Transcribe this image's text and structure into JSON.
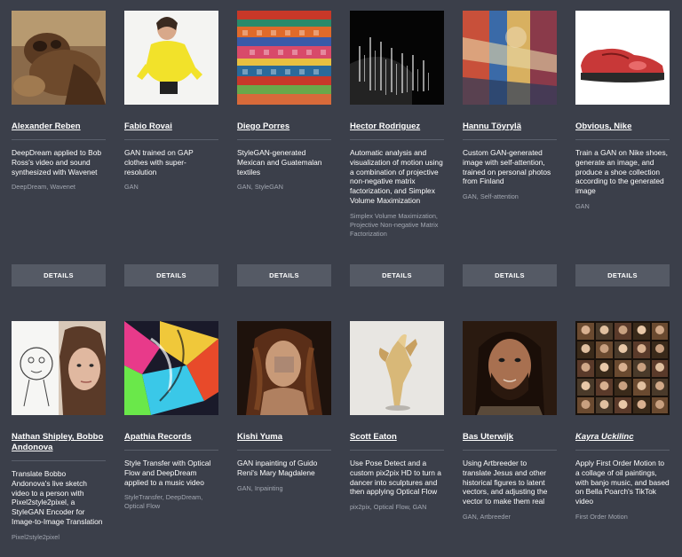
{
  "cards": [
    {
      "artist": "Alexander Reben",
      "description": "DeepDream applied to Bob Ross's video and sound synthesized with Wavenet",
      "tags": "DeepDream, Wavenet",
      "details_label": "DETAILS"
    },
    {
      "artist": "Fabio Rovai",
      "description": "GAN trained on GAP clothes with super-resolution",
      "tags": "GAN",
      "details_label": "DETAILS"
    },
    {
      "artist": "Diego Porres",
      "description": "StyleGAN-generated Mexican and Guatemalan textiles",
      "tags": "GAN, StyleGAN",
      "details_label": "DETAILS"
    },
    {
      "artist": "Hector Rodriguez",
      "description": "Automatic analysis and visualization of motion using a combination of projective non-negative matrix factorization, and Simplex Volume Maximization",
      "tags": "Simplex Volume Maximization, Projective Non-negative Matrix Factorization",
      "details_label": "DETAILS"
    },
    {
      "artist": "Hannu Töyrylä",
      "description": "Custom GAN-generated image with self-attention, trained on personal photos from Finland",
      "tags": "GAN, Self-attention",
      "details_label": "DETAILS"
    },
    {
      "artist": "Obvious, Nike",
      "description": "Train a GAN on Nike shoes, generate an image, and produce a shoe collection according to the generated image",
      "tags": "GAN",
      "details_label": "DETAILS"
    },
    {
      "artist": "Nathan Shipley, Bobbo Andonova",
      "description": "Translate Bobbo Andonova's live sketch video to a person with Pixel2style2pixel, a StyleGAN Encoder for Image-to-Image Translation",
      "tags": "Pixel2style2pixel"
    },
    {
      "artist": "Apathia Records",
      "description": "Style Transfer with Optical Flow and DeepDream applied to a music video",
      "tags": "StyleTransfer, DeepDream, Optical Flow"
    },
    {
      "artist": "Kishi Yuma",
      "description": "GAN inpainting of Guido Reni's Mary Magdalene",
      "tags": "GAN, Inpainting"
    },
    {
      "artist": "Scott Eaton",
      "description": "Use Pose Detect and a custom pix2pix HD to turn a dancer into sculptures and then applying Optical Flow",
      "tags": "pix2pix, Optical Flow, GAN"
    },
    {
      "artist": "Bas Uterwijk",
      "description": "Using Artbreeder to translate Jesus and other historical figures to latent vectors, and adjusting the vector to make them real",
      "tags": "GAN, Artbreeder"
    },
    {
      "artist": "Kayra Uckilinc",
      "description": "Apply First Order Motion to a collage of oil paintings, with banjo music, and based on Bella Poarch's TikTok video",
      "tags": "First Order Motion"
    }
  ]
}
